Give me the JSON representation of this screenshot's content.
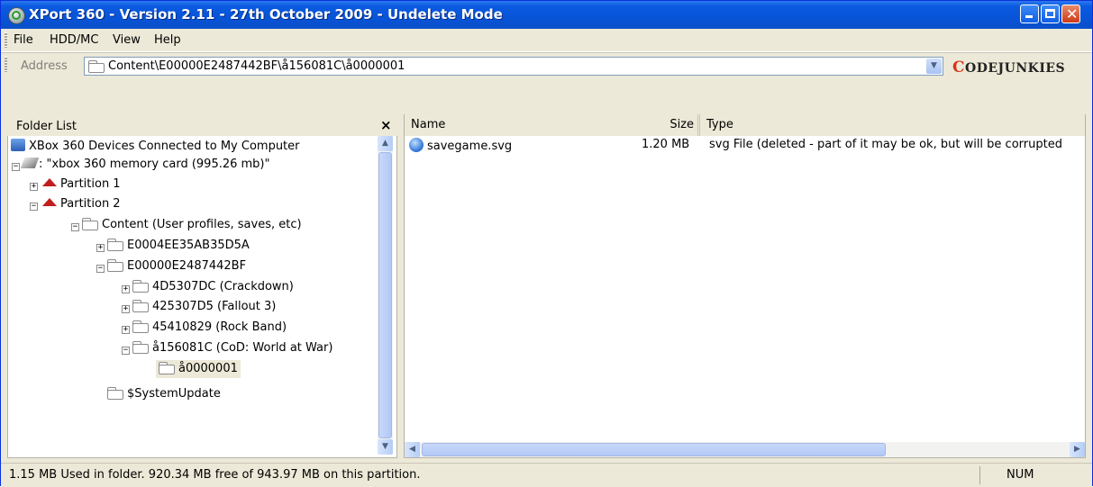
{
  "window": {
    "title": "XPort 360 - Version 2.11 - 27th October 2009 - Undelete Mode",
    "accent": "#0a5ae0"
  },
  "menu": [
    "File",
    "HDD/MC",
    "View",
    "Help"
  ],
  "address": {
    "label": "Address",
    "value": "Content\\E00000E2487442BF\\å156081C\\å0000001",
    "brand": "CODEJUNKIES",
    "brand_first": "C",
    "brand_rest": "ODEJUNKIES"
  },
  "folder_list": {
    "title": "Folder List",
    "close": "×",
    "nodes": [
      {
        "label": "XBox 360 Devices Connected to My Computer",
        "icon": "devices-icon"
      },
      {
        "label": ": \"xbox 360 memory card (995.26 mb)\"",
        "icon": "memory-card-icon",
        "expander": "−"
      },
      {
        "label": "Partition 1",
        "icon": "partition-icon",
        "expander": "+"
      },
      {
        "label": "Partition 2",
        "icon": "partition-icon",
        "expander": "−"
      },
      {
        "label": "Content (User profiles, saves, etc)",
        "icon": "folder-icon",
        "expander": "−"
      },
      {
        "label": "E0004EE35AB35D5A",
        "icon": "folder-icon",
        "expander": "+"
      },
      {
        "label": "E00000E2487442BF",
        "icon": "folder-icon",
        "expander": "−"
      },
      {
        "label": "4D5307DC (Crackdown)",
        "icon": "folder-icon",
        "expander": "+"
      },
      {
        "label": "425307D5 (Fallout 3)",
        "icon": "folder-icon",
        "expander": "+"
      },
      {
        "label": "45410829 (Rock Band)",
        "icon": "folder-icon",
        "expander": "+"
      },
      {
        "label": "å156081C (CoD: World at War)",
        "icon": "folder-icon",
        "expander": "−"
      },
      {
        "label": "å0000001",
        "icon": "folder-icon",
        "selected": true
      },
      {
        "label": "$SystemUpdate",
        "icon": "folder-icon"
      }
    ]
  },
  "file_list": {
    "columns": [
      "Name",
      "Size",
      "Type"
    ],
    "rows": [
      {
        "name": "savegame.svg",
        "size": "1.20 MB",
        "type": "svg File (deleted - part of it may be ok, but will be corrupted"
      }
    ]
  },
  "status": {
    "text": "1.15 MB Used in folder. 920.34 MB free of 943.97 MB on this partition.",
    "num": "NUM"
  }
}
